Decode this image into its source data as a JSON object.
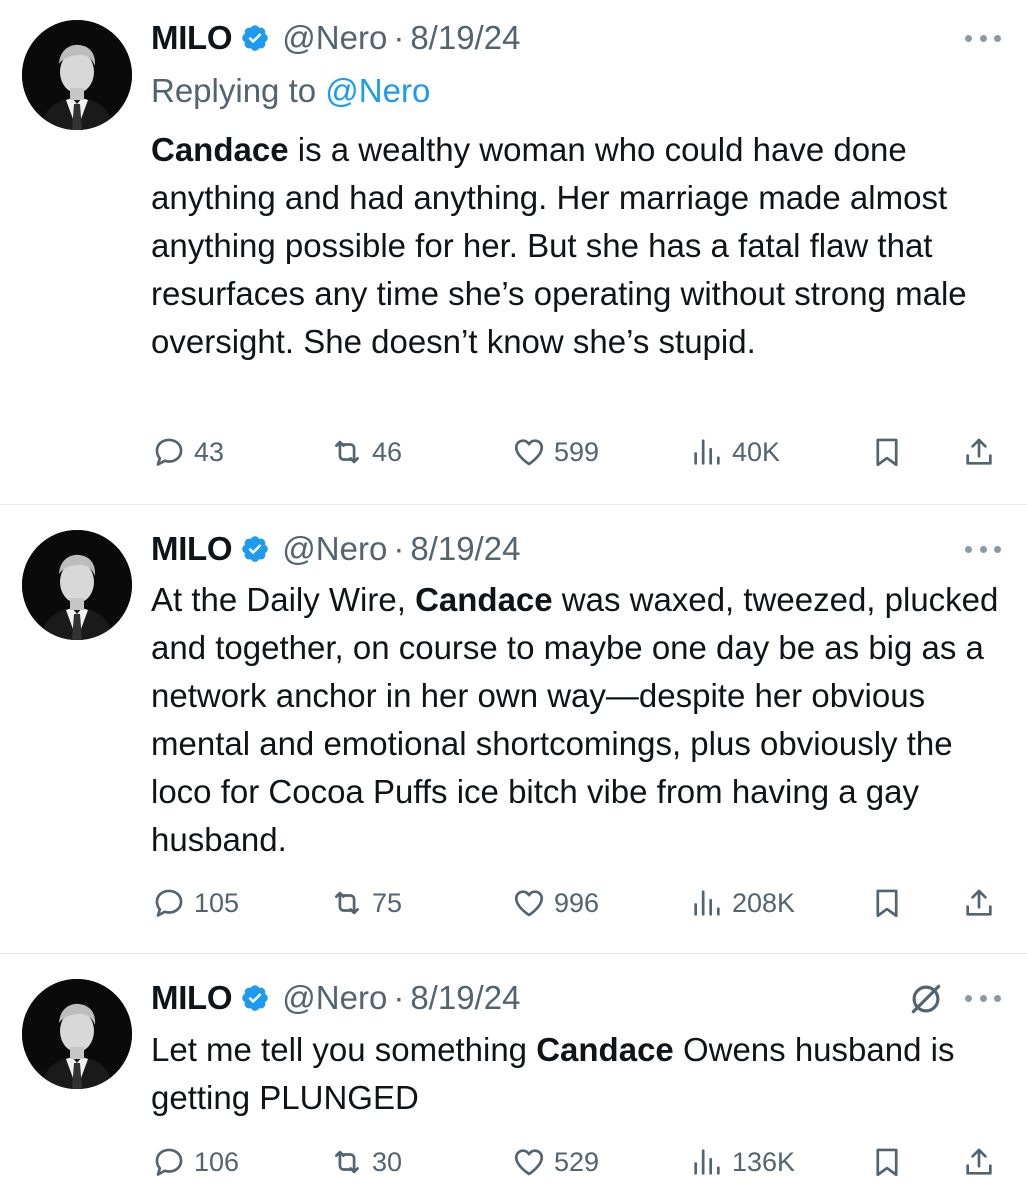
{
  "tweets": [
    {
      "name": "MILO",
      "handle": "@Nero",
      "separator": "·",
      "date": "8/19/24",
      "replying_prefix": "Replying to ",
      "replying_handle": "@Nero",
      "text_parts": [
        {
          "bold": true,
          "text": "Candace"
        },
        {
          "bold": false,
          "text": " is a wealthy woman who could have done anything and had anything. Her marriage made almost anything possible for her. But she has a fatal flaw that resurfaces any time she’s operating without strong male oversight. She doesn’t know she’s stupid."
        }
      ],
      "replies": "43",
      "reposts": "46",
      "likes": "599",
      "views": "40K"
    },
    {
      "name": "MILO",
      "handle": "@Nero",
      "separator": "·",
      "date": "8/19/24",
      "text_parts": [
        {
          "bold": false,
          "text": "At the Daily Wire, "
        },
        {
          "bold": true,
          "text": "Candace"
        },
        {
          "bold": false,
          "text": " was waxed, tweezed, plucked and together, on course to maybe one day be as big as a network anchor in her own way—despite her obvious mental and emotional shortcomings, plus obviously the loco for Cocoa Puffs ice bitch vibe from having a gay husband."
        }
      ],
      "replies": "105",
      "reposts": "75",
      "likes": "996",
      "views": "208K"
    },
    {
      "name": "MILO",
      "handle": "@Nero",
      "separator": "·",
      "date": "8/19/24",
      "text_parts": [
        {
          "bold": false,
          "text": "Let me tell you something "
        },
        {
          "bold": true,
          "text": "Candace"
        },
        {
          "bold": false,
          "text": " Owens husband is getting PLUNGED"
        }
      ],
      "replies": "106",
      "reposts": "30",
      "likes": "529",
      "views": "136K"
    }
  ],
  "icons": {
    "verified": "verified-badge-icon",
    "more": "more-options-icon",
    "reply": "reply-icon",
    "repost": "repost-icon",
    "like": "like-icon",
    "views": "views-icon",
    "bookmark": "bookmark-icon",
    "share": "share-icon",
    "muted": "muted-conversation-icon"
  },
  "colors": {
    "text": "#0f1419",
    "secondary": "#536471",
    "link": "#1d9bf0",
    "verified": "#1d9bf0",
    "divider": "#e6e9ec"
  }
}
